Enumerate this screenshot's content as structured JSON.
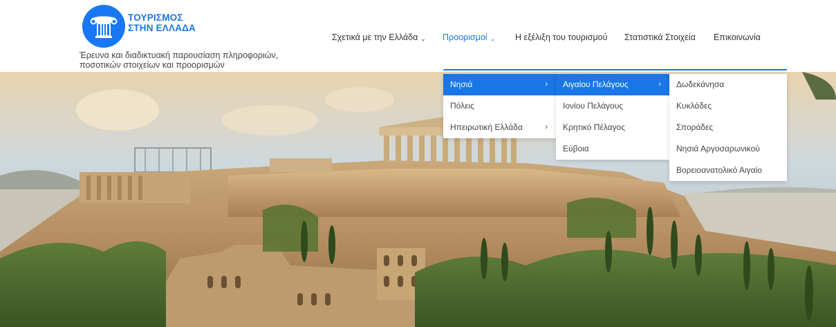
{
  "brand": {
    "title_line1": "ΤΟΥΡΙΣΜΟΣ",
    "title_line2": "ΣΤΗΝ ΕΛΛΑΔΑ",
    "tagline_line1": "Έρευνα και διαδικτυακή παρουσίαση πληροφοριών,",
    "tagline_line2": "ποσοτικών στοιχείων και προορισμών",
    "logo_icon": "greek-column-icon",
    "accent_color": "#1976e8"
  },
  "nav": {
    "items": [
      {
        "label": "Σχετικά με την Ελλάδα",
        "has_caret": true,
        "active": false
      },
      {
        "label": "Προορισμοί",
        "has_caret": true,
        "active": true
      },
      {
        "label": "Η εξέλιξη του τουρισμού",
        "has_caret": false,
        "active": false
      },
      {
        "label": "Στατιστικά Στοιχεία",
        "has_caret": false,
        "active": false
      },
      {
        "label": "Επικοινωνία",
        "has_caret": false,
        "active": false
      }
    ],
    "caret_glyph": "⌄"
  },
  "menu_level1": [
    {
      "label": "Νησιά",
      "arrow": "›",
      "active": true
    },
    {
      "label": "Πόλεις",
      "arrow": "",
      "active": false
    },
    {
      "label": "Ηπειρωτική Ελλάδα",
      "arrow": "›",
      "active": false
    }
  ],
  "menu_level2": [
    {
      "label": "Αιγαίου Πελάγους",
      "arrow": "›",
      "active": true
    },
    {
      "label": "Ιονίου Πελάγους",
      "arrow": "",
      "active": false
    },
    {
      "label": "Κρητικό Πέλαγος",
      "arrow": "",
      "active": false
    },
    {
      "label": "Εύβοια",
      "arrow": "",
      "active": false
    }
  ],
  "menu_level3": [
    {
      "label": "Δωδεκάνησα",
      "active": false
    },
    {
      "label": "Κυκλάδες",
      "active": false
    },
    {
      "label": "Σποράδες",
      "active": false
    },
    {
      "label": "Νησιά Αργοσαρωνικού",
      "active": false
    },
    {
      "label": "Βορειοανατολικό Αιγαίο",
      "active": false
    }
  ],
  "hero": {
    "image": "acropolis-athens-photo"
  }
}
